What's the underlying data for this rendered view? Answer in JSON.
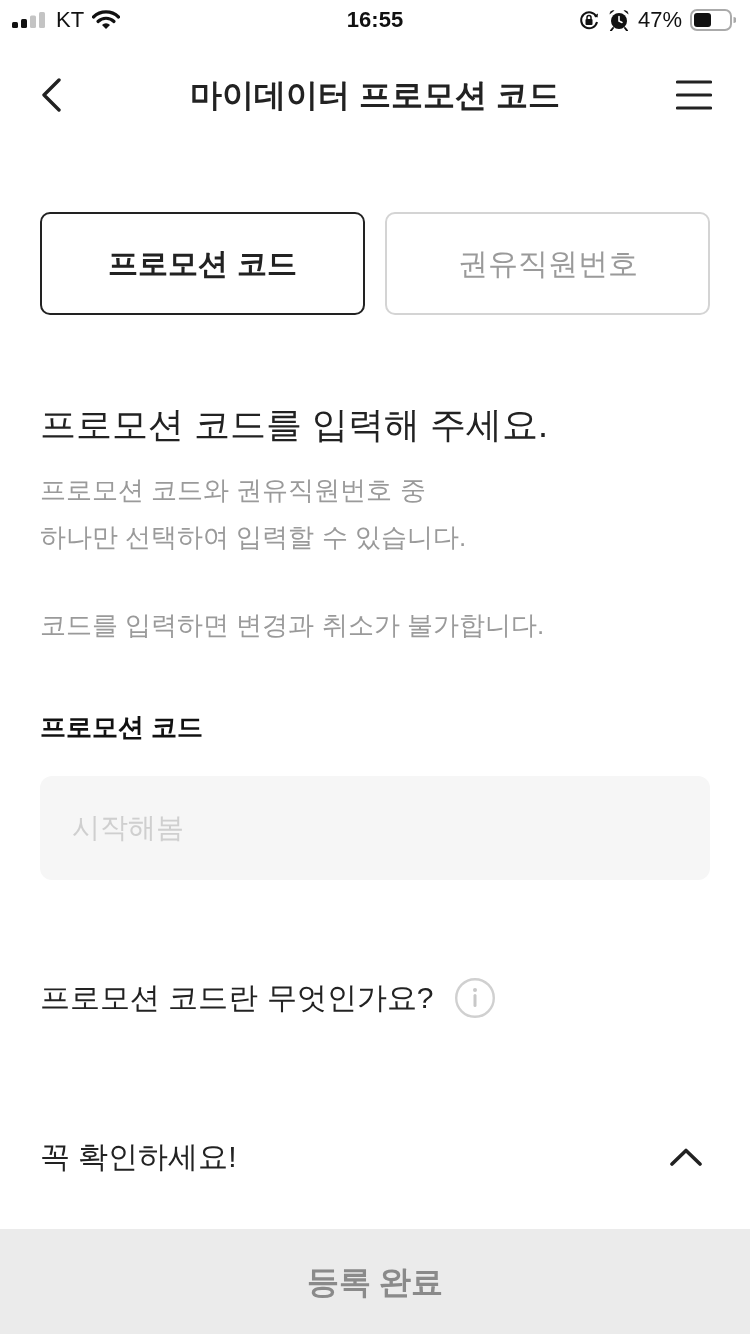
{
  "status_bar": {
    "carrier": "KT",
    "time": "16:55",
    "battery": "47%"
  },
  "header": {
    "title": "마이데이터 프로모션 코드"
  },
  "tabs": [
    {
      "label": "프로모션 코드",
      "selected": true
    },
    {
      "label": "권유직원번호",
      "selected": false
    }
  ],
  "heading": "프로모션 코드를 입력해 주세요.",
  "description": [
    {
      "lines": [
        "프로모션 코드와 권유직원번호 중",
        "하나만 선택하여 입력할 수 있습니다."
      ]
    },
    {
      "lines": [
        "코드를 입력하면 변경과 취소가 불가합니다."
      ]
    }
  ],
  "field": {
    "label": "프로모션 코드",
    "placeholder": "시작해봄"
  },
  "info_link": {
    "label": "프로모션 코드란 무엇인가요?"
  },
  "notice": {
    "title": "꼭 확인하세요!",
    "expanded": true
  },
  "submit_button": {
    "label": "등록 완료",
    "disabled": true
  }
}
